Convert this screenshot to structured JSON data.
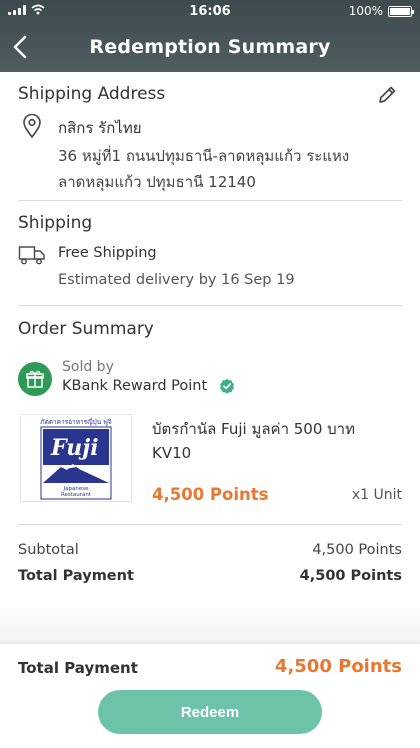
{
  "status_bar": {
    "carrier_signal": "signal-icon",
    "time": "16:06",
    "battery": "100%"
  },
  "header": {
    "title": "Redemption Summary"
  },
  "shipping_address": {
    "title": "Shipping Address",
    "name": "กสิกร รักไทย",
    "line1": "36 หมู่ที่1 ถนนปทุมธานี-ลาดหลุมแก้ว ระแหง",
    "line2": "ลาดหลุมแก้ว ปทุมธานี 12140"
  },
  "shipping": {
    "title": "Shipping",
    "method": "Free Shipping",
    "eta": "Estimated delivery by 16 Sep 19"
  },
  "order_summary": {
    "title": "Order Summary",
    "sold_by_label": "Sold by",
    "seller": "KBank Reward Point",
    "product": {
      "name": "บัตรกำนัล Fuji มูลค่า 500 บาท KV10",
      "points": "4,500 Points",
      "qty": "x1 Unit",
      "image_text": {
        "header": "ภัตตาคารอาหารญี่ปุ่น ฟูจิ",
        "brand": "Fuji",
        "sub1": "Japanese",
        "sub2": "Restaurant"
      }
    }
  },
  "totals": {
    "subtotal_label": "Subtotal",
    "subtotal_value": "4,500 Points",
    "total_label": "Total Payment",
    "total_value": "4,500 Points"
  },
  "footer": {
    "total_label": "Total Payment",
    "total_value": "4,500 Points",
    "redeem_label": "Redeem"
  },
  "colors": {
    "accent": "#e87830",
    "button": "#6cc3a9",
    "header": "#46545a",
    "seller_green": "#2e9a57"
  }
}
